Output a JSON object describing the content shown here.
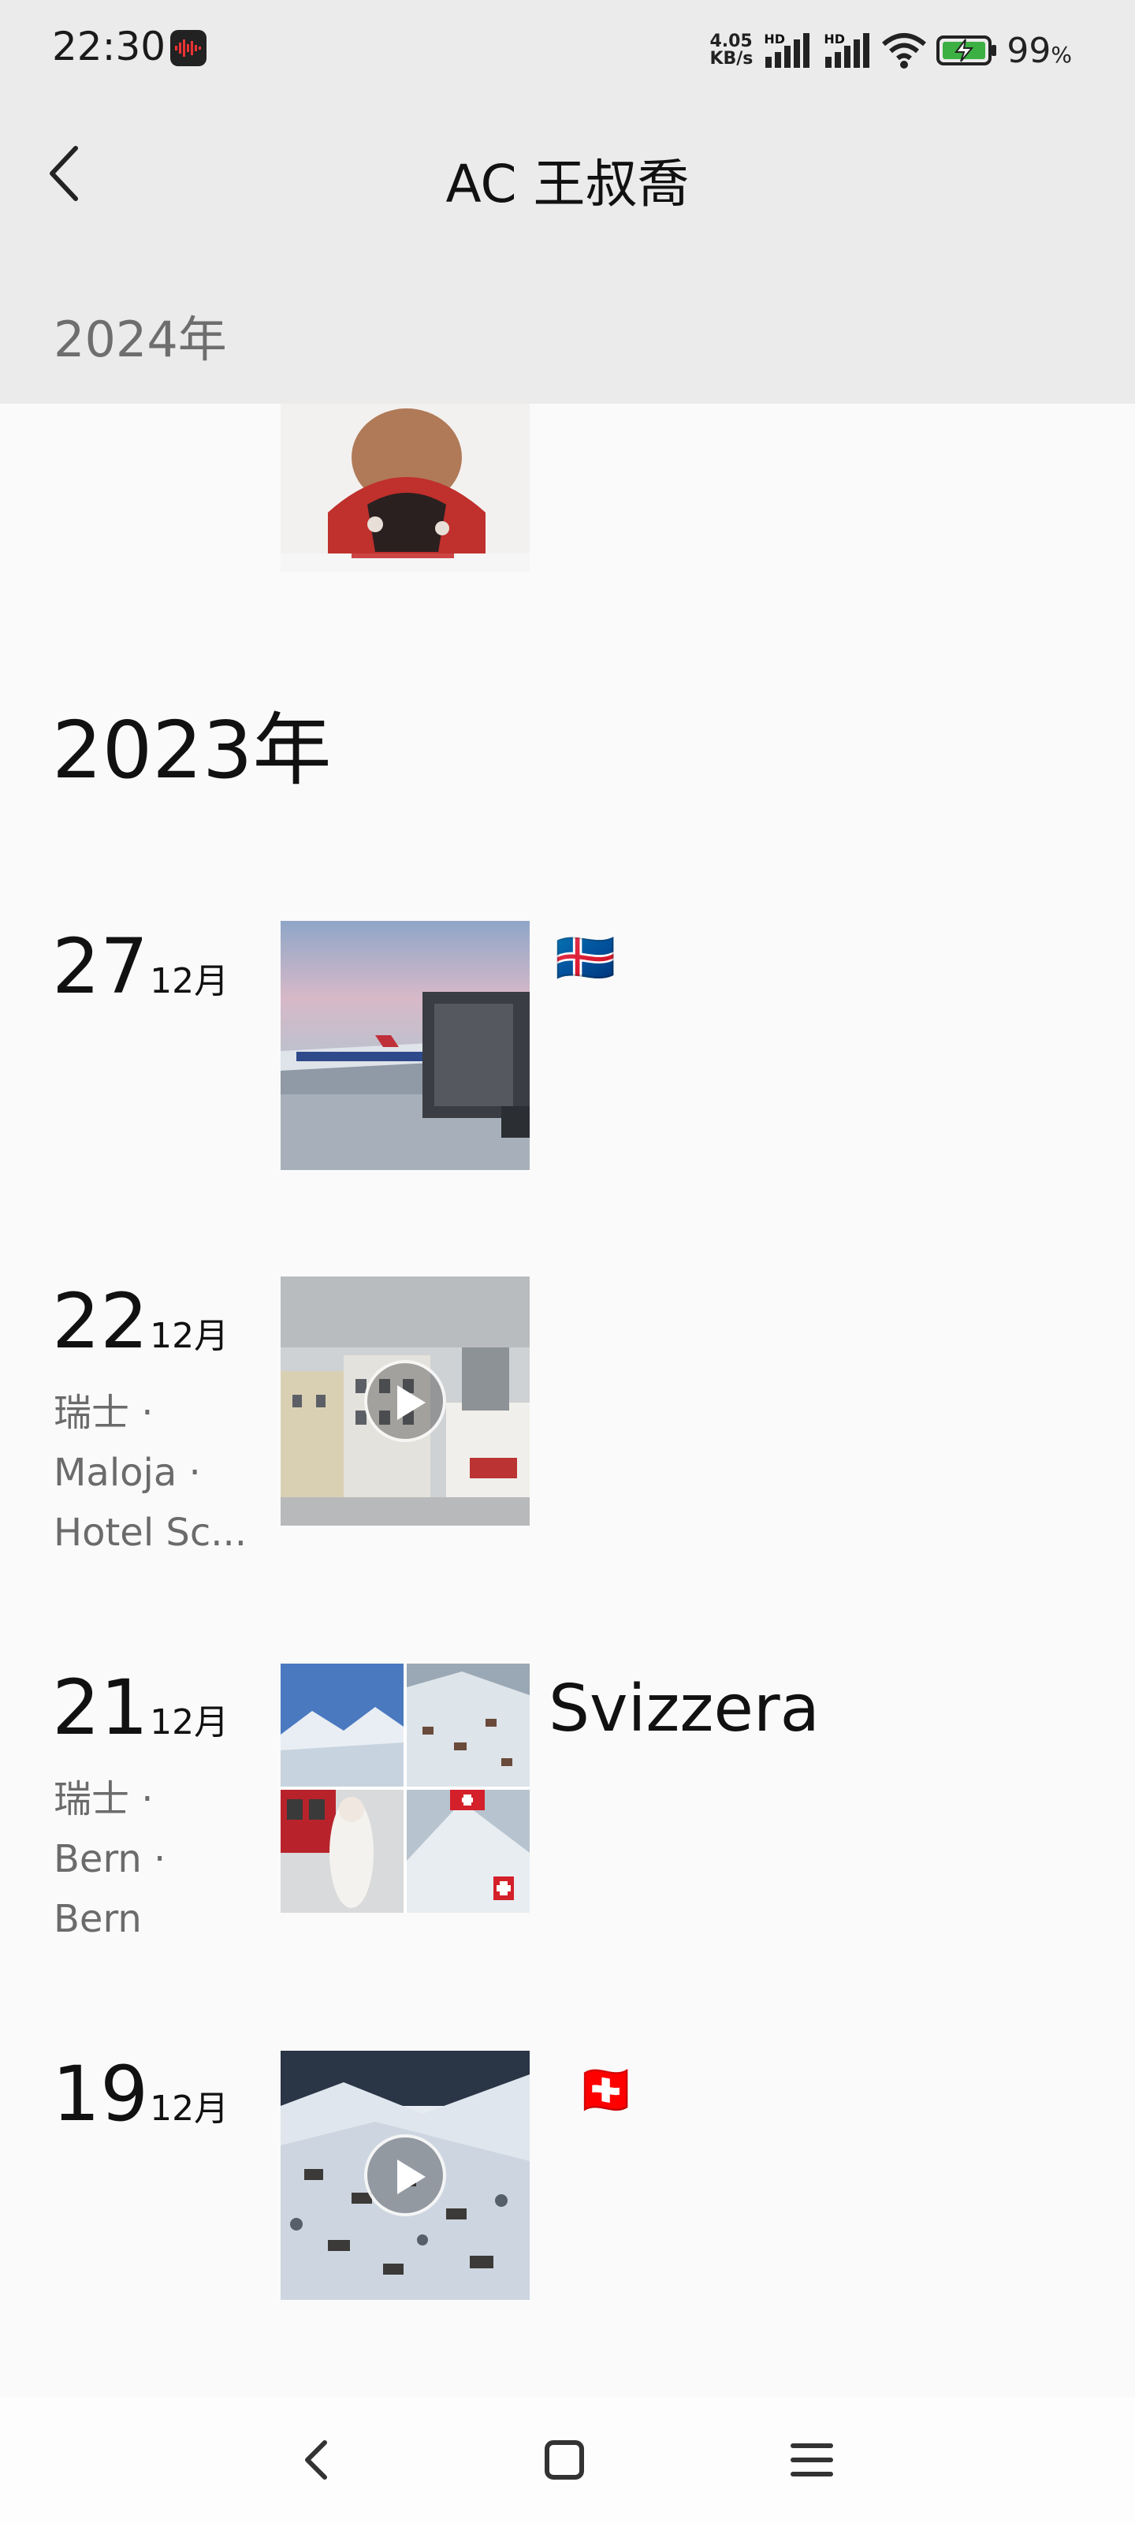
{
  "status_bar": {
    "time": "22:30",
    "net_speed_value": "4.05",
    "net_speed_unit": "KB/s",
    "signal_label": "HD",
    "battery_percent": "99",
    "battery_unit": "%"
  },
  "header": {
    "title": "AC 王叔喬",
    "sticky_year": "2024年"
  },
  "timeline": {
    "year_heading": "2023年",
    "entries": [
      {
        "day": "27",
        "month": "12月",
        "caption": "🇮🇸"
      },
      {
        "day": "22",
        "month": "12月",
        "location": [
          "瑞士 ·",
          "Maloja ·",
          "Hotel Sc..."
        ],
        "is_video": true
      },
      {
        "day": "21",
        "month": "12月",
        "location": [
          "瑞士 ·",
          "Bern ·",
          "Bern"
        ],
        "caption": "Svizzera"
      },
      {
        "day": "19",
        "month": "12月",
        "caption": "🇨🇭",
        "is_video": true
      }
    ]
  },
  "icons": {
    "back": "back-arrow-icon",
    "recorder": "sound-recorder-icon",
    "wifi": "wifi-icon",
    "battery": "battery-charging-icon",
    "nav_back": "nav-back-icon",
    "nav_home": "nav-home-icon",
    "nav_menu": "nav-menu-icon"
  }
}
